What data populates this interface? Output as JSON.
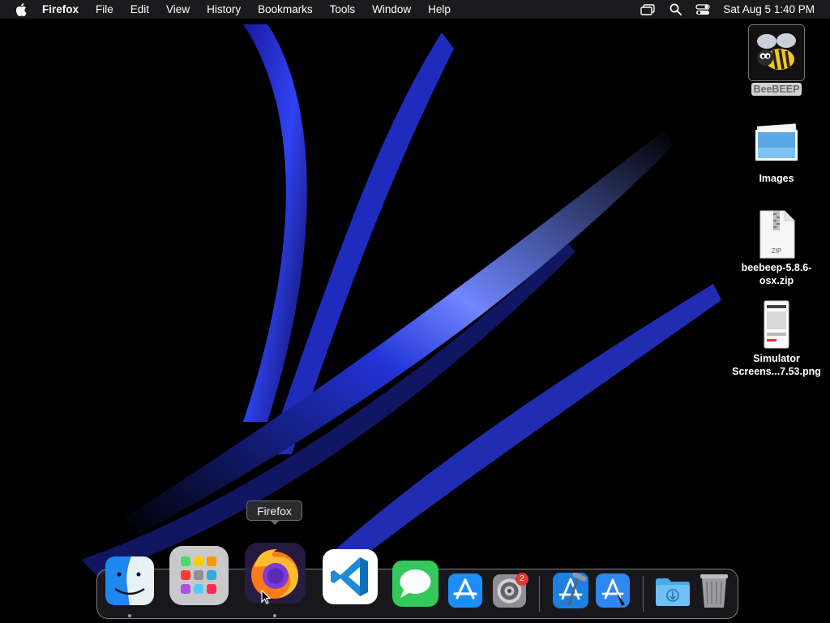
{
  "menubar": {
    "app_name": "Firefox",
    "items": [
      "File",
      "Edit",
      "View",
      "History",
      "Bookmarks",
      "Tools",
      "Window",
      "Help"
    ],
    "clock": "Sat Aug 5  1:40 PM",
    "status_icons": [
      "screen-mirroring-icon",
      "spotlight-search-icon",
      "control-center-icon"
    ]
  },
  "desktop": {
    "items": [
      {
        "label": "BeeBEEP",
        "icon": "beebeep-app-icon",
        "selected": true
      },
      {
        "label": "Images",
        "icon": "images-folder-icon"
      },
      {
        "label": "beebeep-5.8.6-osx.zip",
        "label_lines": [
          "beebeep-5.8.6-",
          "osx.zip"
        ],
        "icon": "zip-archive-icon"
      },
      {
        "label": "Simulator Screens...7.53.png",
        "label_lines": [
          "Simulator",
          "Screens...7.53.png"
        ],
        "icon": "png-file-icon"
      }
    ]
  },
  "dock": {
    "tooltip": "Firefox",
    "apps": [
      {
        "name": "Finder",
        "icon": "finder-icon",
        "running": true
      },
      {
        "name": "Launchpad",
        "icon": "launchpad-icon"
      },
      {
        "name": "Firefox",
        "icon": "firefox-icon",
        "running": true
      },
      {
        "name": "Visual Studio Code",
        "icon": "vscode-icon"
      },
      {
        "name": "Messages",
        "icon": "messages-icon"
      },
      {
        "name": "App Store",
        "icon": "app-store-icon"
      },
      {
        "name": "System Settings",
        "icon": "system-settings-icon",
        "badge": "2"
      },
      {
        "name": "Xcode",
        "icon": "xcode-icon"
      },
      {
        "name": "Simulator",
        "icon": "simulator-icon"
      },
      {
        "name": "Downloads",
        "icon": "downloads-folder-icon"
      },
      {
        "name": "Trash",
        "icon": "trash-icon"
      }
    ]
  },
  "colors": {
    "wallpaper_accent": "#2b3bff",
    "menubar_bg": "#1b1b1d",
    "badge": "#e53935"
  }
}
